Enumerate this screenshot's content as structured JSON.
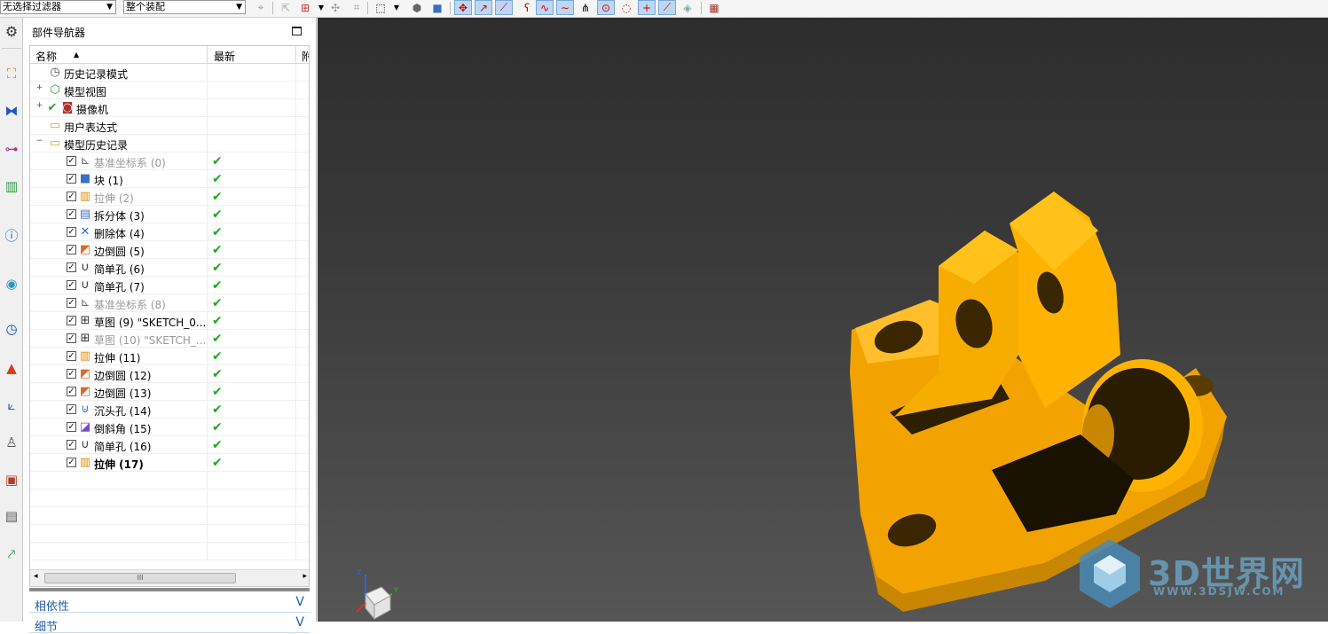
{
  "toolbar": {
    "filter_value": "无选择过滤器",
    "assembly_value": "整个装配",
    "icons": [
      "filter-icon",
      "assembly-icon",
      "wcs-icon",
      "snap-icon",
      "move-icon",
      "drop-icon",
      "select-box-icon",
      "shade-icon",
      "solid-icon",
      "point-snap-icon",
      "end-point-icon",
      "mid-point-icon",
      "curve-icon",
      "spline-icon",
      "curve2-icon",
      "intersect-icon",
      "center-icon",
      "quadrant-icon",
      "plus-icon",
      "line-icon",
      "face-icon",
      "grid-icon"
    ]
  },
  "resource_bar": {
    "icons": [
      "settings-icon",
      "assembly-navigator-icon",
      "constraint-navigator-icon",
      "part-navigator-icon",
      "reuse-library-icon",
      "info-icon",
      "web-browser-icon",
      "history-icon",
      "system-materials-icon",
      "process-studio-icon",
      "roles-icon",
      "part-template-icon",
      "hd3d-icon",
      "system-scene-icon"
    ]
  },
  "navigator": {
    "title": "部件导航器",
    "col_name": "名称",
    "col_latest": "最新",
    "col_extra": "附",
    "scroll_label": "III",
    "tree": [
      {
        "label": "历史记录模式",
        "icon": "clock-icon",
        "level": 0,
        "expander": "",
        "check": false,
        "ok": false,
        "style": ""
      },
      {
        "label": "模型视图",
        "icon": "model-view-icon",
        "level": 0,
        "expander": "+",
        "check": false,
        "ok": false,
        "style": ""
      },
      {
        "label": "摄像机",
        "icon": "camera-icon",
        "level": 0,
        "expander": "+",
        "check": false,
        "ok": false,
        "greencheck": true,
        "style": ""
      },
      {
        "label": "用户表达式",
        "icon": "folder-icon",
        "level": 0,
        "expander": "",
        "check": false,
        "ok": false,
        "style": ""
      },
      {
        "label": "模型历史记录",
        "icon": "folder-open-icon",
        "level": 0,
        "expander": "−",
        "check": false,
        "ok": false,
        "style": ""
      },
      {
        "label": "基准坐标系 (0)",
        "icon": "datum-csys-icon",
        "level": 1,
        "check": true,
        "ok": true,
        "style": "dim"
      },
      {
        "label": "块 (1)",
        "icon": "block-icon",
        "level": 1,
        "check": true,
        "ok": true,
        "style": ""
      },
      {
        "label": "拉伸 (2)",
        "icon": "extrude-icon",
        "level": 1,
        "check": true,
        "ok": true,
        "style": "dim"
      },
      {
        "label": "拆分体 (3)",
        "icon": "split-body-icon",
        "level": 1,
        "check": true,
        "ok": true,
        "style": ""
      },
      {
        "label": "删除体 (4)",
        "icon": "delete-body-icon",
        "level": 1,
        "check": true,
        "ok": true,
        "style": ""
      },
      {
        "label": "边倒圆 (5)",
        "icon": "edge-blend-icon",
        "level": 1,
        "check": true,
        "ok": true,
        "style": ""
      },
      {
        "label": "简单孔 (6)",
        "icon": "simple-hole-icon",
        "level": 1,
        "check": true,
        "ok": true,
        "style": ""
      },
      {
        "label": "简单孔 (7)",
        "icon": "simple-hole-icon",
        "level": 1,
        "check": true,
        "ok": true,
        "style": ""
      },
      {
        "label": "基准坐标系 (8)",
        "icon": "datum-csys-icon",
        "level": 1,
        "check": true,
        "ok": true,
        "style": "dim"
      },
      {
        "label": "草图 (9) \"SKETCH_0...",
        "icon": "sketch-icon",
        "level": 1,
        "check": true,
        "ok": true,
        "style": ""
      },
      {
        "label": "草图 (10) \"SKETCH_...",
        "icon": "sketch-icon",
        "level": 1,
        "check": true,
        "ok": true,
        "style": "dim"
      },
      {
        "label": "拉伸 (11)",
        "icon": "extrude-icon",
        "level": 1,
        "check": true,
        "ok": true,
        "style": ""
      },
      {
        "label": "边倒圆 (12)",
        "icon": "edge-blend-icon",
        "level": 1,
        "check": true,
        "ok": true,
        "style": ""
      },
      {
        "label": "边倒圆 (13)",
        "icon": "edge-blend-icon",
        "level": 1,
        "check": true,
        "ok": true,
        "style": ""
      },
      {
        "label": "沉头孔 (14)",
        "icon": "counterbore-hole-icon",
        "level": 1,
        "check": true,
        "ok": true,
        "style": ""
      },
      {
        "label": "倒斜角 (15)",
        "icon": "chamfer-icon",
        "level": 1,
        "check": true,
        "ok": true,
        "style": ""
      },
      {
        "label": "简单孔 (16)",
        "icon": "simple-hole-icon",
        "level": 1,
        "check": true,
        "ok": true,
        "style": ""
      },
      {
        "label": "拉伸 (17)",
        "icon": "extrude-icon",
        "level": 1,
        "check": true,
        "ok": true,
        "style": "bold"
      }
    ],
    "sections": [
      {
        "label": "相依性",
        "chevron": "V"
      },
      {
        "label": "细节",
        "chevron": "V"
      }
    ]
  },
  "viewport": {
    "part_color": "#ffb300",
    "bg_top": "#2d2d2d",
    "bg_bottom": "#565656",
    "watermark": "3D世界网",
    "watermark_url": "WWW.3DSJW.COM",
    "triad_labels": {
      "z": "Z",
      "y": "Y"
    }
  }
}
